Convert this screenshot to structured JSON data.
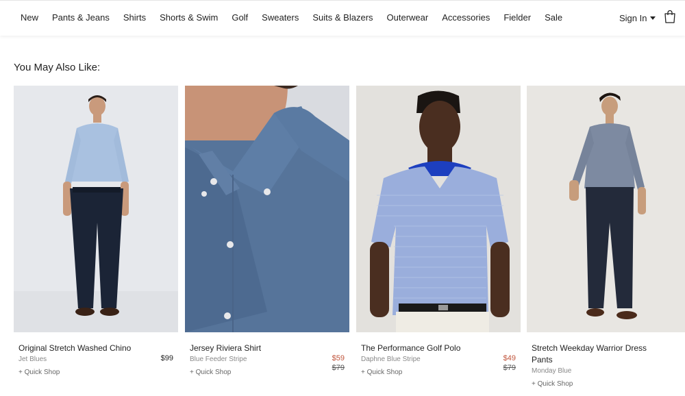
{
  "nav": {
    "items": [
      "New",
      "Pants & Jeans",
      "Shirts",
      "Shorts & Swim",
      "Golf",
      "Sweaters",
      "Suits & Blazers",
      "Outerwear",
      "Accessories",
      "Fielder",
      "Sale"
    ],
    "sign_in": "Sign In"
  },
  "section": {
    "title": "You May Also Like:"
  },
  "products": [
    {
      "name": "Original Stretch Washed Chino",
      "price": "$99",
      "original_price": "",
      "color": "Jet Blues",
      "quick_shop": "+ Quick Shop"
    },
    {
      "name": "Jersey Riviera Shirt",
      "price": "$59",
      "original_price": "$79",
      "color": "Blue Feeder Stripe",
      "quick_shop": "+ Quick Shop"
    },
    {
      "name": "The Performance Golf Polo",
      "price": "$49",
      "original_price": "$79",
      "color": "Daphne Blue Stripe",
      "quick_shop": "+ Quick Shop"
    },
    {
      "name": "Stretch Weekday Warrior Dress Pants",
      "price": "",
      "original_price": "",
      "color": "Monday Blue",
      "quick_shop": "+ Quick Shop"
    }
  ],
  "colors": {
    "sale_price": "#c0543b",
    "text": "#222222",
    "muted": "#888888"
  }
}
